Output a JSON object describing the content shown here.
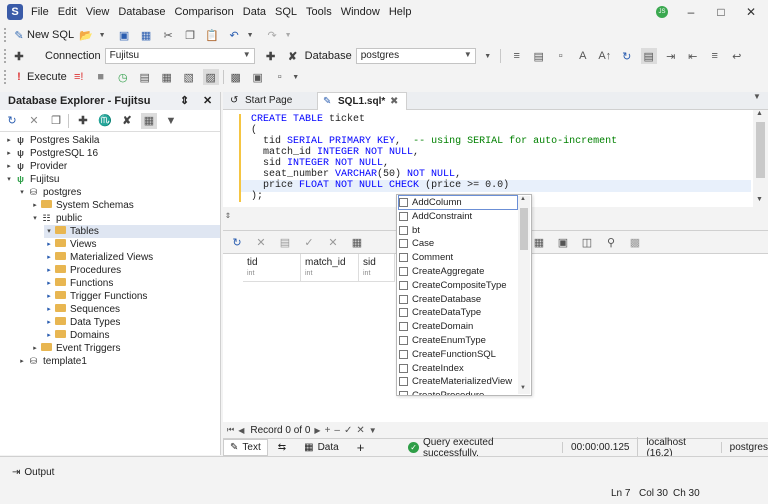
{
  "menu": [
    "File",
    "Edit",
    "View",
    "Database",
    "Comparison",
    "Data",
    "SQL",
    "Tools",
    "Window",
    "Help"
  ],
  "avatar_initials": "JS",
  "toolbar1": {
    "new_sql": "New SQL"
  },
  "toolbar2": {
    "connection_label": "Connection",
    "connection_value": "Fujitsu",
    "database_label": "Database",
    "database_value": "postgres"
  },
  "toolbar3": {
    "execute": "Execute"
  },
  "explorer": {
    "title": "Database Explorer - Fujitsu",
    "nodes": {
      "postgres_sakila": "Postgres Sakila",
      "postgresql16": "PostgreSQL 16",
      "provider": "Provider",
      "fujitsu": "Fujitsu",
      "postgres": "postgres",
      "system_schemas": "System Schemas",
      "public": "public",
      "tables": "Tables",
      "views": "Views",
      "mat_views": "Materialized Views",
      "procedures": "Procedures",
      "functions": "Functions",
      "trigger_functions": "Trigger Functions",
      "sequences": "Sequences",
      "data_types": "Data Types",
      "domains": "Domains",
      "event_triggers": "Event Triggers",
      "template1": "template1"
    }
  },
  "tabs": {
    "start_page": "Start Page",
    "sql1": "SQL1.sql*"
  },
  "editor": {
    "l1a": "CREATE TABLE",
    "l1b": " ticket",
    "l2": "(",
    "l3a": "  tid ",
    "l3b": "SERIAL PRIMARY KEY",
    "l3c": ",  ",
    "l3d": "-- using SERIAL for auto-increment",
    "l4a": "  match_id ",
    "l4b": "INTEGER",
    "l4c": " NOT NULL",
    "l4d": ",",
    "l5a": "  sid ",
    "l5b": "INTEGER",
    "l5c": " NOT NULL",
    "l5d": ",",
    "l6a": "  seat_number ",
    "l6b": "VARCHAR",
    "l6c": "(50)",
    "l6d": " NOT NULL",
    "l6e": ",",
    "l7a": "  price ",
    "l7b": "FLOAT",
    "l7c": " NOT NULL",
    "l7d": " CHECK ",
    "l7e": "(price >= 0.0)",
    "l8": ");"
  },
  "autocomplete": [
    "AddColumn",
    "AddConstraint",
    "bt",
    "Case",
    "Comment",
    "CreateAggregate",
    "CreateCompositeType",
    "CreateDatabase",
    "CreateDataType",
    "CreateDomain",
    "CreateEnumType",
    "CreateFunctionSQL",
    "CreateIndex",
    "CreateMaterializedView",
    "CreateProcedure"
  ],
  "grid": {
    "columns": [
      {
        "name": "tid",
        "type": "int"
      },
      {
        "name": "match_id",
        "type": "int"
      },
      {
        "name": "sid",
        "type": "int"
      }
    ]
  },
  "recbar": {
    "record": "Record 0 of 0"
  },
  "status": {
    "text_tab": "Text",
    "data_tab": "Data",
    "message": "Query executed successfully.",
    "elapsed": "00:00:00.125",
    "server": "localhost (16.2)",
    "database": "postgres"
  },
  "output_label": "Output",
  "position": {
    "ln": "Ln 7",
    "col": "Col 30",
    "ch": "Ch 30"
  }
}
